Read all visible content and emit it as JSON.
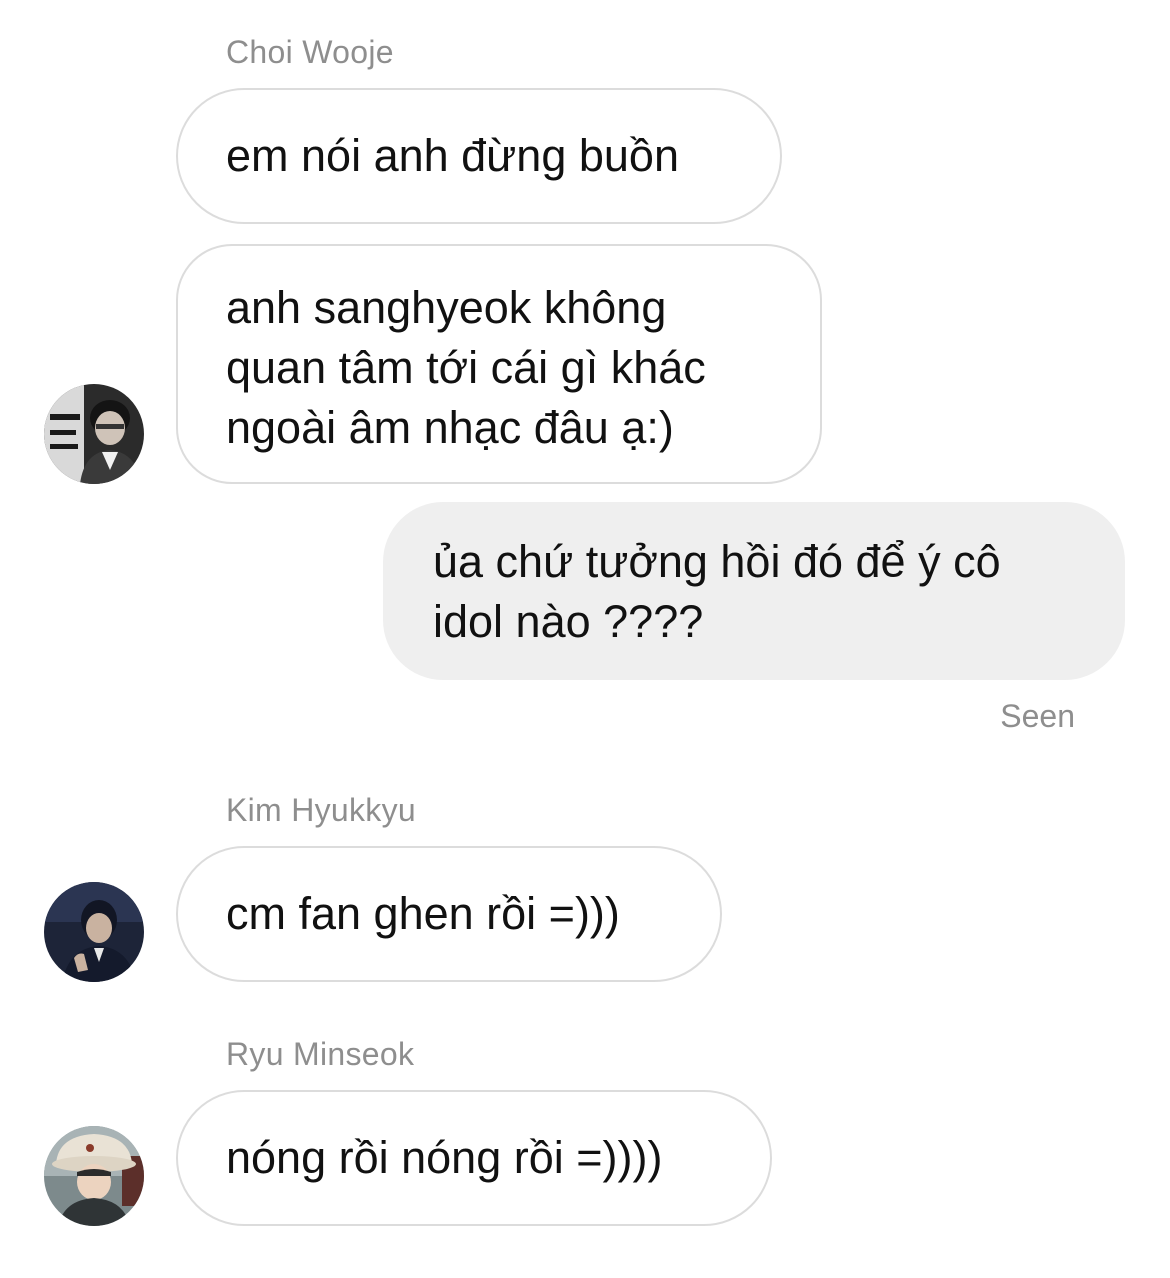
{
  "messages": [
    {
      "sender": "Choi Wooje",
      "bubbles": [
        {
          "lines": [
            "em nói anh đừng buồn"
          ]
        },
        {
          "lines": [
            "anh sanghyeok không",
            "quan tâm tới cái gì khác",
            "ngoài âm nhạc đâu ạ:)"
          ]
        }
      ],
      "avatar": "profile-photo-choi-wooje"
    },
    {
      "sender": "me",
      "bubbles": [
        {
          "lines": [
            "ủa chứ tưởng hồi đó để ý cô",
            "idol nào ????"
          ]
        }
      ],
      "status": "Seen"
    },
    {
      "sender": "Kim Hyukkyu",
      "bubbles": [
        {
          "lines": [
            "cm fan ghen rồi =)))"
          ]
        }
      ],
      "avatar": "profile-photo-kim-hyukkyu"
    },
    {
      "sender": "Ryu Minseok",
      "bubbles": [
        {
          "lines": [
            "nóng rồi nóng rồi =))))"
          ]
        }
      ],
      "avatar": "profile-photo-ryu-minseok"
    }
  ],
  "colors": {
    "incoming_border": "#dcdcdc",
    "outgoing_bg": "#efefef",
    "meta_text": "#8e8e8e"
  }
}
